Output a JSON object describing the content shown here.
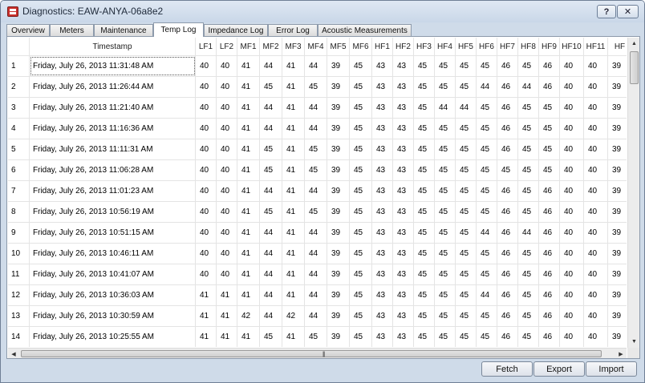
{
  "window": {
    "title": "Diagnostics: EAW-ANYA-06a8e2",
    "help_label": "?",
    "close_label": "✕"
  },
  "tabs": [
    {
      "label": "Overview",
      "active": false
    },
    {
      "label": "Meters",
      "active": false
    },
    {
      "label": "Maintenance",
      "active": false
    },
    {
      "label": "Temp Log",
      "active": true
    },
    {
      "label": "Impedance Log",
      "active": false
    },
    {
      "label": "Error Log",
      "active": false
    },
    {
      "label": "Acoustic Measurements",
      "active": false
    }
  ],
  "table": {
    "timestamp_header": "Timestamp",
    "columns": [
      "LF1",
      "LF2",
      "MF1",
      "MF2",
      "MF3",
      "MF4",
      "MF5",
      "MF6",
      "HF1",
      "HF2",
      "HF3",
      "HF4",
      "HF5",
      "HF6",
      "HF7",
      "HF8",
      "HF9",
      "HF10",
      "HF11",
      "HF"
    ],
    "rows": [
      {
        "num": "1",
        "timestamp": "Friday, July 26, 2013 11:31:48 AM",
        "values": [
          "40",
          "40",
          "41",
          "44",
          "41",
          "44",
          "39",
          "45",
          "43",
          "43",
          "45",
          "45",
          "45",
          "45",
          "46",
          "45",
          "46",
          "40",
          "40",
          "39"
        ]
      },
      {
        "num": "2",
        "timestamp": "Friday, July 26, 2013 11:26:44 AM",
        "values": [
          "40",
          "40",
          "41",
          "45",
          "41",
          "45",
          "39",
          "45",
          "43",
          "43",
          "45",
          "45",
          "45",
          "44",
          "46",
          "44",
          "46",
          "40",
          "40",
          "39"
        ]
      },
      {
        "num": "3",
        "timestamp": "Friday, July 26, 2013 11:21:40 AM",
        "values": [
          "40",
          "40",
          "41",
          "44",
          "41",
          "44",
          "39",
          "45",
          "43",
          "43",
          "45",
          "44",
          "44",
          "45",
          "46",
          "45",
          "45",
          "40",
          "40",
          "39"
        ]
      },
      {
        "num": "4",
        "timestamp": "Friday, July 26, 2013 11:16:36 AM",
        "values": [
          "40",
          "40",
          "41",
          "44",
          "41",
          "44",
          "39",
          "45",
          "43",
          "43",
          "45",
          "45",
          "45",
          "45",
          "46",
          "45",
          "45",
          "40",
          "40",
          "39"
        ]
      },
      {
        "num": "5",
        "timestamp": "Friday, July 26, 2013 11:11:31 AM",
        "values": [
          "40",
          "40",
          "41",
          "45",
          "41",
          "45",
          "39",
          "45",
          "43",
          "43",
          "45",
          "45",
          "45",
          "45",
          "46",
          "45",
          "45",
          "40",
          "40",
          "39"
        ]
      },
      {
        "num": "6",
        "timestamp": "Friday, July 26, 2013 11:06:28 AM",
        "values": [
          "40",
          "40",
          "41",
          "45",
          "41",
          "45",
          "39",
          "45",
          "43",
          "43",
          "45",
          "45",
          "45",
          "45",
          "45",
          "45",
          "45",
          "40",
          "40",
          "39"
        ]
      },
      {
        "num": "7",
        "timestamp": "Friday, July 26, 2013 11:01:23 AM",
        "values": [
          "40",
          "40",
          "41",
          "44",
          "41",
          "44",
          "39",
          "45",
          "43",
          "43",
          "45",
          "45",
          "45",
          "45",
          "46",
          "45",
          "46",
          "40",
          "40",
          "39"
        ]
      },
      {
        "num": "8",
        "timestamp": "Friday, July 26, 2013 10:56:19 AM",
        "values": [
          "40",
          "40",
          "41",
          "45",
          "41",
          "45",
          "39",
          "45",
          "43",
          "43",
          "45",
          "45",
          "45",
          "45",
          "46",
          "45",
          "46",
          "40",
          "40",
          "39"
        ]
      },
      {
        "num": "9",
        "timestamp": "Friday, July 26, 2013 10:51:15 AM",
        "values": [
          "40",
          "40",
          "41",
          "44",
          "41",
          "44",
          "39",
          "45",
          "43",
          "43",
          "45",
          "45",
          "45",
          "44",
          "46",
          "44",
          "46",
          "40",
          "40",
          "39"
        ]
      },
      {
        "num": "10",
        "timestamp": "Friday, July 26, 2013 10:46:11 AM",
        "values": [
          "40",
          "40",
          "41",
          "44",
          "41",
          "44",
          "39",
          "45",
          "43",
          "43",
          "45",
          "45",
          "45",
          "45",
          "46",
          "45",
          "46",
          "40",
          "40",
          "39"
        ]
      },
      {
        "num": "11",
        "timestamp": "Friday, July 26, 2013 10:41:07 AM",
        "values": [
          "40",
          "40",
          "41",
          "44",
          "41",
          "44",
          "39",
          "45",
          "43",
          "43",
          "45",
          "45",
          "45",
          "45",
          "46",
          "45",
          "46",
          "40",
          "40",
          "39"
        ]
      },
      {
        "num": "12",
        "timestamp": "Friday, July 26, 2013 10:36:03 AM",
        "values": [
          "41",
          "41",
          "41",
          "44",
          "41",
          "44",
          "39",
          "45",
          "43",
          "43",
          "45",
          "45",
          "45",
          "44",
          "46",
          "45",
          "46",
          "40",
          "40",
          "39"
        ]
      },
      {
        "num": "13",
        "timestamp": "Friday, July 26, 2013 10:30:59 AM",
        "values": [
          "41",
          "41",
          "42",
          "44",
          "42",
          "44",
          "39",
          "45",
          "43",
          "43",
          "45",
          "45",
          "45",
          "45",
          "46",
          "45",
          "46",
          "40",
          "40",
          "39"
        ]
      },
      {
        "num": "14",
        "timestamp": "Friday, July 26, 2013 10:25:55 AM",
        "values": [
          "41",
          "41",
          "41",
          "45",
          "41",
          "45",
          "39",
          "45",
          "43",
          "43",
          "45",
          "45",
          "45",
          "45",
          "46",
          "45",
          "46",
          "40",
          "40",
          "39"
        ]
      }
    ]
  },
  "scrollbar": {
    "grip": "|||"
  },
  "buttons": {
    "fetch": "Fetch",
    "export": "Export",
    "import": "Import"
  }
}
